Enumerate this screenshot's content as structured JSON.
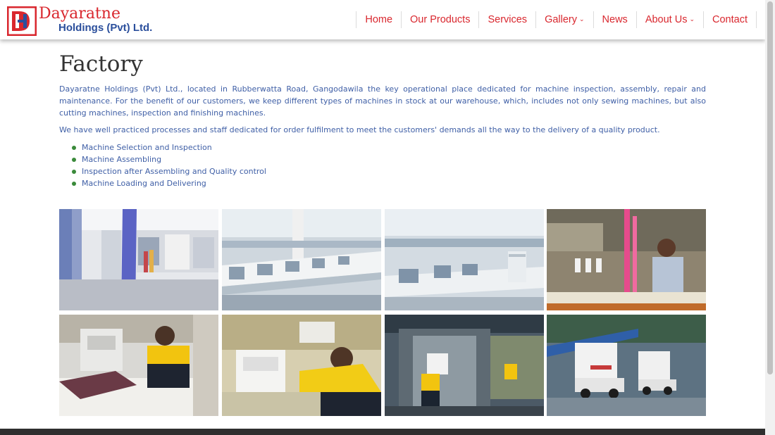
{
  "header": {
    "logo": {
      "name": "Dayaratne",
      "sub": "Holdings (Pvt) Ltd.",
      "mark": "DH"
    },
    "nav": [
      {
        "label": "Home",
        "has_dropdown": false
      },
      {
        "label": "Our Products",
        "has_dropdown": false
      },
      {
        "label": "Services",
        "has_dropdown": false
      },
      {
        "label": "Gallery",
        "has_dropdown": true
      },
      {
        "label": "News",
        "has_dropdown": false
      },
      {
        "label": "About Us",
        "has_dropdown": true
      },
      {
        "label": "Contact",
        "has_dropdown": false
      }
    ]
  },
  "main": {
    "title": "Factory",
    "paragraph1": "Dayaratne Holdings (Pvt) Ltd., located in Rubberwatta Road, Gangodawila the key operational place dedicated for machine inspection, assembly, repair and maintenance.  For the benefit of our customers, we keep different types of machines in stock at our warehouse, which, includes not only sewing machines, but also cutting machines, inspection and finishing machines.",
    "paragraph2": "We have well practiced processes and staff dedicated for order fulfilment to meet the customers' demands all the way to the delivery of a quality product.",
    "list": [
      "Machine Selection and Inspection",
      "Machine Assembling",
      "Inspection after Assembling and Quality control",
      "Machine Loading and Delivering"
    ]
  },
  "gallery": {
    "photos": [
      {
        "subject": "office-reception-photo"
      },
      {
        "subject": "sewing-machine-hall-photo"
      },
      {
        "subject": "machine-warehouse-photo"
      },
      {
        "subject": "worker-thread-inspection-photo"
      },
      {
        "subject": "worker-machine-testing-photo"
      },
      {
        "subject": "worker-repair-photo"
      },
      {
        "subject": "truck-loading-photo"
      },
      {
        "subject": "delivery-trucks-photo"
      }
    ]
  },
  "colors": {
    "brand_red": "#d9272e",
    "brand_blue": "#2b4f9c",
    "text_blue": "#3f5fa6",
    "bullet_green": "#3a8a3a",
    "footer": "#2f2f2f"
  }
}
